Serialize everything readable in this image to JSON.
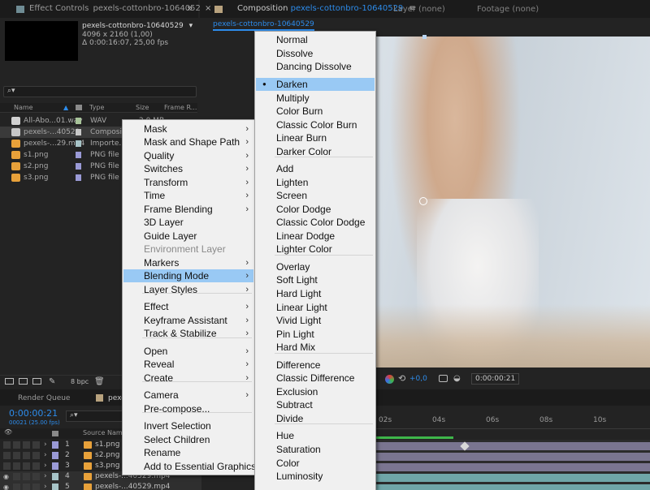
{
  "effect_panel": {
    "tab_label": "Effect Controls",
    "tab_file": "pexels-cottonbro-10640529.mp4",
    "chevrons": "»"
  },
  "project_info": {
    "name": "pexels-cottonbro-10640529",
    "dropdown": "▾",
    "dims": "4096 x 2160 (1,00)",
    "duration": "Δ 0:00:16:07, 25,00 fps"
  },
  "project_search": {
    "icon": "⌕▾"
  },
  "project_columns": {
    "name": "Name",
    "type": "Type",
    "size": "Size",
    "frame": "Frame R..."
  },
  "project_items": [
    {
      "name": "All-Abo...01.wav",
      "type": "WAV",
      "size": "2,0 MB",
      "icon_color": "#d0d0d0",
      "label_color": "#a8c49a"
    },
    {
      "name": "pexels-...40529",
      "type": "Compositio",
      "size": "",
      "icon_color": "#c8c8c8",
      "label_color": "#c8c8c8"
    },
    {
      "name": "pexels-...29.mp4",
      "type": "Importe...E",
      "size": "",
      "icon_color": "#e8a13a",
      "label_color": "#a7c4c8"
    },
    {
      "name": "s1.png",
      "type": "PNG file",
      "size": "",
      "icon_color": "#e8a13a",
      "label_color": "#9a9ad6"
    },
    {
      "name": "s2.png",
      "type": "PNG file",
      "size": "",
      "icon_color": "#e8a13a",
      "label_color": "#9a9ad6"
    },
    {
      "name": "s3.png",
      "type": "PNG file",
      "size": "",
      "icon_color": "#e8a13a",
      "label_color": "#9a9ad6"
    }
  ],
  "project_footer": {
    "bpc": "8 bpc"
  },
  "comp_panel": {
    "tab_label": "Composition",
    "tab_comp": "pexels-cottonbro-10640529",
    "menu_icon": "≡",
    "layer_tab": "Layer (none)",
    "footage_tab": "Footage (none)",
    "flowchart_tab": "pexels-cottonbro-10640529"
  },
  "viewer_footer": {
    "exposure": "+0,0",
    "timecode": "0:00:00:21"
  },
  "render_queue": {
    "label": "Render Queue",
    "comp_tab": "pexels-..."
  },
  "timeline": {
    "timecode": "0:00:00:21",
    "frame_info": "00021 (25.00 fps)",
    "search_icon": "⌕▾",
    "source_name_header": "Source Name",
    "ruler": [
      "02s",
      "04s",
      "06s",
      "08s",
      "10s"
    ],
    "layers": [
      {
        "num": "1",
        "name": "s1.png"
      },
      {
        "num": "2",
        "name": "s2.png"
      },
      {
        "num": "3",
        "name": "s3.png"
      },
      {
        "num": "4",
        "name": "pexels-...40529.mp4"
      },
      {
        "num": "5",
        "name": "pexels-...40529.mp4"
      }
    ]
  },
  "context_menu": {
    "items": [
      {
        "label": "Mask",
        "submenu": true
      },
      {
        "label": "Mask and Shape Path",
        "submenu": true
      },
      {
        "label": "Quality",
        "submenu": true
      },
      {
        "label": "Switches",
        "submenu": true
      },
      {
        "label": "Transform",
        "submenu": true
      },
      {
        "label": "Time",
        "submenu": true
      },
      {
        "label": "Frame Blending",
        "submenu": true
      },
      {
        "label": "3D Layer",
        "submenu": false
      },
      {
        "label": "Guide Layer",
        "submenu": false
      },
      {
        "label": "Environment Layer",
        "submenu": false,
        "disabled": true
      },
      {
        "label": "Markers",
        "submenu": true
      },
      {
        "label": "Blending Mode",
        "submenu": true,
        "highlighted": true
      },
      {
        "label": "Layer Styles",
        "submenu": true
      },
      {
        "label": "Effect",
        "submenu": true
      },
      {
        "label": "Keyframe Assistant",
        "submenu": true
      },
      {
        "label": "Track & Stabilize",
        "submenu": true
      },
      {
        "label": "Open",
        "submenu": true
      },
      {
        "label": "Reveal",
        "submenu": true
      },
      {
        "label": "Create",
        "submenu": true
      },
      {
        "label": "Camera",
        "submenu": true
      },
      {
        "label": "Pre-compose...",
        "submenu": false
      },
      {
        "label": "Invert Selection",
        "submenu": false
      },
      {
        "label": "Select Children",
        "submenu": false
      },
      {
        "label": "Rename",
        "submenu": false
      },
      {
        "label": "Add to Essential Graphics",
        "submenu": false
      }
    ],
    "arrow": "›"
  },
  "blend_menu": {
    "items": [
      {
        "label": "Normal"
      },
      {
        "label": "Dissolve"
      },
      {
        "label": "Dancing Dissolve"
      },
      {
        "label": "Darken",
        "selected": true
      },
      {
        "label": "Multiply"
      },
      {
        "label": "Color Burn"
      },
      {
        "label": "Classic Color Burn"
      },
      {
        "label": "Linear Burn"
      },
      {
        "label": "Darker Color"
      },
      {
        "label": "Add"
      },
      {
        "label": "Lighten"
      },
      {
        "label": "Screen"
      },
      {
        "label": "Color Dodge"
      },
      {
        "label": "Classic Color Dodge"
      },
      {
        "label": "Linear Dodge"
      },
      {
        "label": "Lighter Color"
      },
      {
        "label": "Overlay"
      },
      {
        "label": "Soft Light"
      },
      {
        "label": "Hard Light"
      },
      {
        "label": "Linear Light"
      },
      {
        "label": "Vivid Light"
      },
      {
        "label": "Pin Light"
      },
      {
        "label": "Hard Mix"
      },
      {
        "label": "Difference"
      },
      {
        "label": "Classic Difference"
      },
      {
        "label": "Exclusion"
      },
      {
        "label": "Subtract"
      },
      {
        "label": "Divide"
      },
      {
        "label": "Hue"
      },
      {
        "label": "Saturation"
      },
      {
        "label": "Color"
      },
      {
        "label": "Luminosity"
      }
    ],
    "bullet": "●"
  }
}
